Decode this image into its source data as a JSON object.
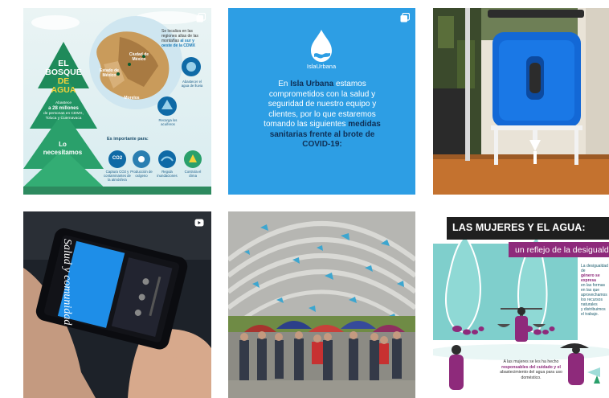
{
  "grid": {
    "tiles": [
      {
        "id": "bosque-de-agua",
        "type": "carousel"
      },
      {
        "id": "medidas-sanitarias",
        "type": "carousel"
      },
      {
        "id": "cisterna-azul",
        "type": "image"
      },
      {
        "id": "telefono-video",
        "type": "video"
      },
      {
        "id": "evento-kiosko",
        "type": "image"
      },
      {
        "id": "mujeres-y-agua",
        "type": "image"
      }
    ]
  },
  "tile1": {
    "title_line1": "EL",
    "title_line2": "BOSQUE",
    "title_line3": "DE AGUA",
    "sub_line1": "Abastece",
    "sub_line2": "a 28 millones",
    "sub_line3": "de personas en CDMX,",
    "sub_line4": "Toluca y Cuernavaca",
    "lo_line1": "Lo",
    "lo_line2": "necesitamos",
    "loc_line1": "Se localiza en las",
    "loc_line2": "regiones altas de las",
    "loc_line3": "montañas",
    "loc_bold1": "al sur y",
    "loc_bold2": "oeste de la CDMX",
    "map_ciudad": "Ciudad de México",
    "map_estado": "Estado de México",
    "map_morelos": "Morelos",
    "cap_abastecer": "Abastecer el agua de lluvia",
    "cap_recarga": "Recarga los acuíferos",
    "importante": "Es importante para:",
    "icon1_label": "CO2",
    "bottom_caps": [
      "Captura CO2 y contaminantes de la atmósfera",
      "Producción de oxígeno",
      "Regula inundaciones",
      "Controla el clima"
    ],
    "colors": {
      "tree": "#1f8a5a",
      "map": "#c99b5b",
      "accent": "#f3d23a"
    }
  },
  "tile2": {
    "logo_text": "IslaUrbana",
    "l1_pre": "En ",
    "l1_brand": "Isla Urbana",
    "l1_post": " estamos",
    "l2": "comprometidos con la salud y",
    "l3": "seguridad de nuestro equipo y",
    "l4": "clientes, por lo que estaremos",
    "l5_pre": "tomando las siguientes ",
    "l5_bold": "medidas",
    "l6": "sanitarias frente al brote de",
    "l7": "COVID-19:",
    "colors": {
      "bg": "#2d9ee4",
      "dark": "#0f2f55"
    }
  },
  "tile3": {
    "colors": {
      "tank": "#1368d6",
      "wall": "#e9e3d7"
    }
  },
  "tile4": {
    "phone_text": "Salud y comunidad"
  },
  "tile5": {
    "colors": {
      "roof": "#c8c8c4",
      "confetti": "#3da6cf"
    }
  },
  "tile6": {
    "header": "LAS MUJERES Y EL AGUA:",
    "subheader": "un reflejo de la desigualdad",
    "side_l1": "La desigualdad de",
    "side_l2": "género se expresa",
    "side_l3": "en las formas",
    "side_l4": "en las que",
    "side_l5": "aprovechamos",
    "side_l6": "los recursos",
    "side_l7": "naturales",
    "side_l8": "y distribuimos",
    "side_l9": "el trabajo.",
    "foot_pre": "A las mujeres se les ha hecho",
    "foot_bold": "responsables del cuidado y el",
    "foot_post": "abastecimiento del agua para uso doméstico.",
    "colors": {
      "header_bg": "#1f1f1f",
      "purple": "#8e2a7b",
      "water": "#7fcfcc"
    }
  }
}
